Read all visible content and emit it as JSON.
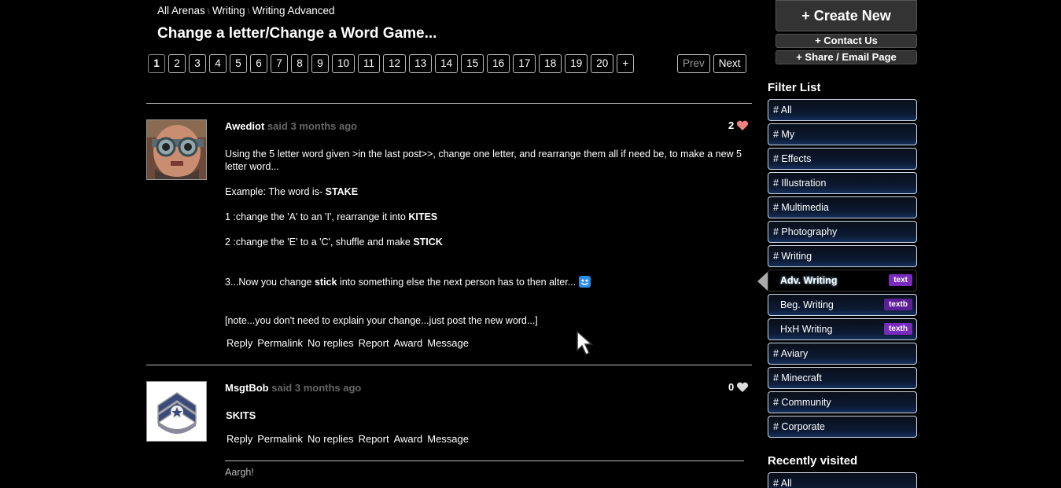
{
  "breadcrumb": [
    "All Arenas",
    "Writing",
    "Writing Advanced"
  ],
  "title": "Change a letter/Change a Word Game...",
  "pagination": {
    "pages": [
      "1",
      "2",
      "3",
      "4",
      "5",
      "6",
      "7",
      "8",
      "9",
      "10",
      "11",
      "12",
      "13",
      "14",
      "15",
      "16",
      "17",
      "18",
      "19",
      "20",
      "+"
    ],
    "current": "1",
    "prev": "Prev",
    "next": "Next"
  },
  "posts": [
    {
      "author": "Awediot",
      "said": "said 3 months ago",
      "likes": "2",
      "avatar_icon": "goggles-man-avatar",
      "body": {
        "intro": "Using the 5 letter word given >in the last post>>, change one letter, and rearrange them all if need be, to make a new 5 letter word...",
        "example_prefix": "Example: The word is- ",
        "example_word": "STAKE",
        "step1_prefix": "1 :change the 'A' to an 'I', rearrange it into ",
        "step1_word": "KITES",
        "step2_prefix": "2 :change the 'E' to a 'C', shuffle and make ",
        "step2_word": "STICK",
        "step3_prefix": "3...Now you change ",
        "step3_word": "stick",
        "step3_suffix": " into something else the next person has to then alter...",
        "note": "[note...you don't need to explain your change...just post the new word...]"
      }
    },
    {
      "author": "MsgtBob",
      "said": "said 3 months ago",
      "likes": "0",
      "avatar_icon": "sergeant-chevron-avatar",
      "body": {
        "text": "SKITS"
      },
      "reply_preview": "Aargh!"
    }
  ],
  "actions": [
    "Reply",
    "Permalink",
    "No replies",
    "Report",
    "Award",
    "Message"
  ],
  "sidebar": {
    "create_new": "+ Create New",
    "contact_us": "+ Contact Us",
    "share": "+ Share / Email Page",
    "filter_heading": "Filter List",
    "filters": [
      {
        "label": "# All"
      },
      {
        "label": "# My"
      },
      {
        "label": "# Effects"
      },
      {
        "label": "# Illustration"
      },
      {
        "label": "# Multimedia"
      },
      {
        "label": "# Photography"
      },
      {
        "label": "# Writing"
      },
      {
        "label": "Adv. Writing",
        "tag": "text",
        "active": true
      },
      {
        "label": "Beg. Writing",
        "tag": "textb"
      },
      {
        "label": "HxH Writing",
        "tag": "texth"
      },
      {
        "label": "# Aviary"
      },
      {
        "label": "# Minecraft"
      },
      {
        "label": "# Community"
      },
      {
        "label": "# Corporate"
      }
    ],
    "recent_heading": "Recently visited",
    "recent": [
      {
        "label": "# All"
      }
    ]
  },
  "colors": {
    "accent_tag": "#7a2bbf",
    "heart_liked": "#f08080",
    "heart_empty": "#dddddd",
    "background": "#000000"
  }
}
